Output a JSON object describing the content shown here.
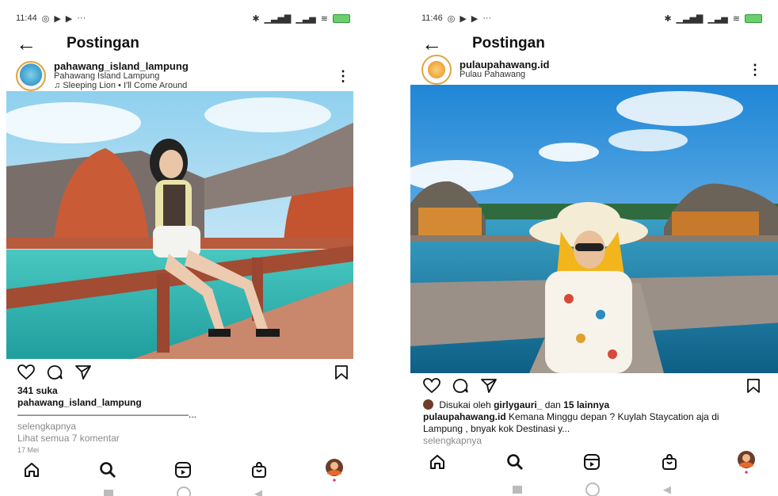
{
  "phone1": {
    "status": {
      "time": "11:44",
      "battery": "66"
    },
    "header_title": "Postingan",
    "post": {
      "username": "pahawang_island_lampung",
      "location": "Pahawang Island Lampung",
      "music": "Sleeping Lion • I'll Come Around",
      "likes": "341 suka",
      "caption_user": "pahawang_island_lampung",
      "caption_line": "——————————————————...",
      "more_text": "selengkapnya",
      "comments": "Lihat semua 7 komentar",
      "date": "17 Mei"
    }
  },
  "phone2": {
    "status": {
      "time": "11:46",
      "battery": "66"
    },
    "header_title": "Postingan",
    "post": {
      "username": "pulaupahawang.id",
      "location": "Pulau Pahawang",
      "liked_prefix": "Disukai oleh",
      "liked_user": "girlygauri_",
      "liked_mid": "dan",
      "liked_others": "15 lainnya",
      "caption_user": "pulaupahawang.id",
      "caption_text": "Kemana Minggu depan ? Kuylah Staycation aja di Lampung , bnyak kok Destinasi y...",
      "more_text": "selengkapnya"
    }
  },
  "icons": {
    "back": "←",
    "more": "⋮"
  },
  "colors": {
    "accent": "#e0a640",
    "muted": "#8a8a8a"
  }
}
